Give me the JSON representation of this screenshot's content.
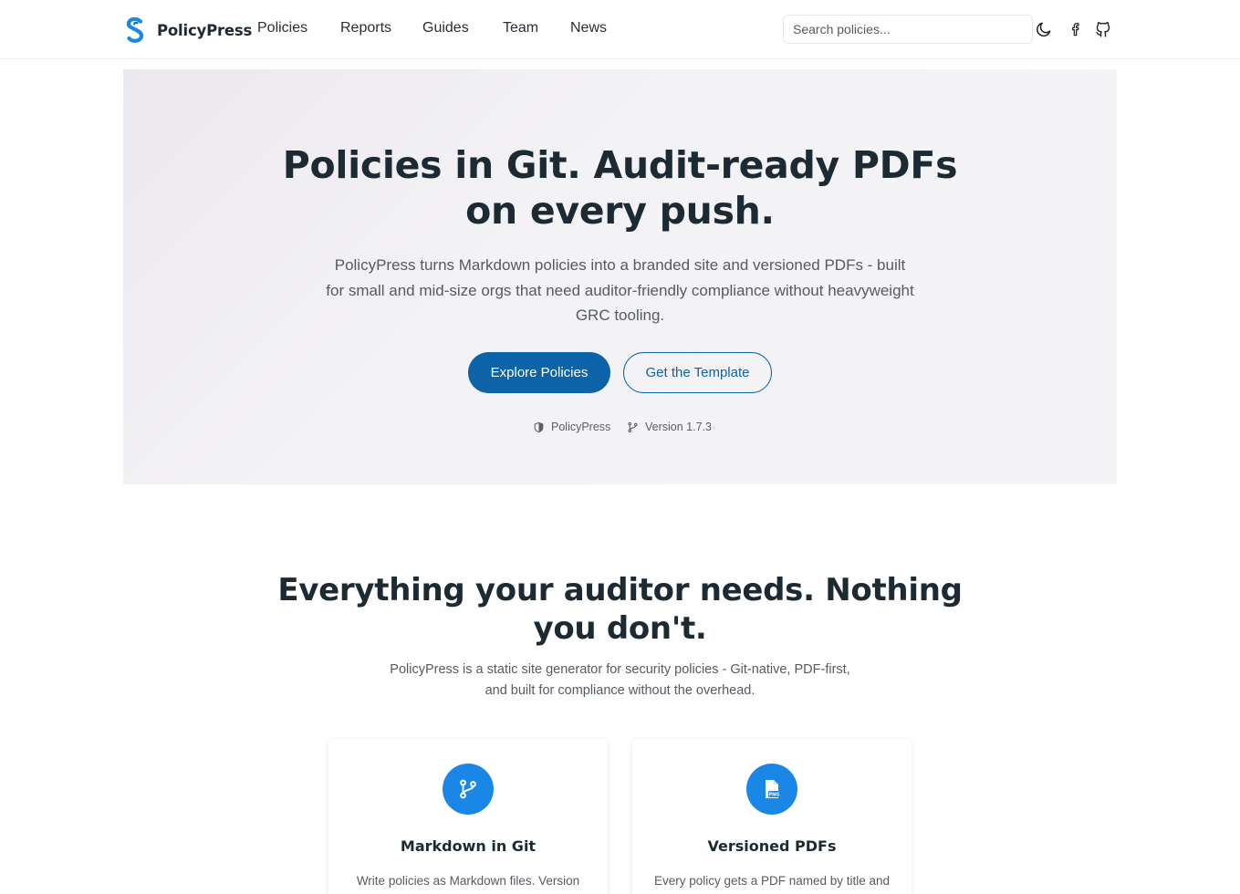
{
  "header": {
    "brand_name": "PolicyPress",
    "nav": [
      "Policies",
      "Reports",
      "Guides",
      "Team",
      "News"
    ],
    "search_placeholder": "Search policies...",
    "icons": [
      "moon-icon",
      "facebook-icon",
      "github-icon"
    ]
  },
  "hero": {
    "title_line1": "Policies in Git. Audit-ready PDFs",
    "title_line2": "on every push.",
    "subtitle": "PolicyPress turns Markdown policies into a branded site and versioned PDFs - built for small and mid-size orgs that need auditor-friendly compliance without heavyweight GRC tooling.",
    "primary_button": "Explore Policies",
    "secondary_button": "Get the Template",
    "meta_brand": "PolicyPress",
    "meta_version": "Version 1.7.3"
  },
  "features": {
    "title_line1": "Everything your auditor needs. Nothing",
    "title_line2": "you don't.",
    "subtitle": "PolicyPress is a static site generator for security policies - Git-native, PDF-first, and built for compliance without the overhead.",
    "cards": [
      {
        "icon": "git-branch-icon",
        "title": "Markdown in Git",
        "text": "Write policies as Markdown files. Version"
      },
      {
        "icon": "file-png-icon",
        "title": "Versioned PDFs",
        "text": "Every policy gets a PDF named by title and"
      }
    ]
  },
  "colors": {
    "accent": "#0d63a8",
    "icon_circle": "#1a87e6",
    "heading": "#1c2a33",
    "hero_bg": "#f3f2f5"
  }
}
